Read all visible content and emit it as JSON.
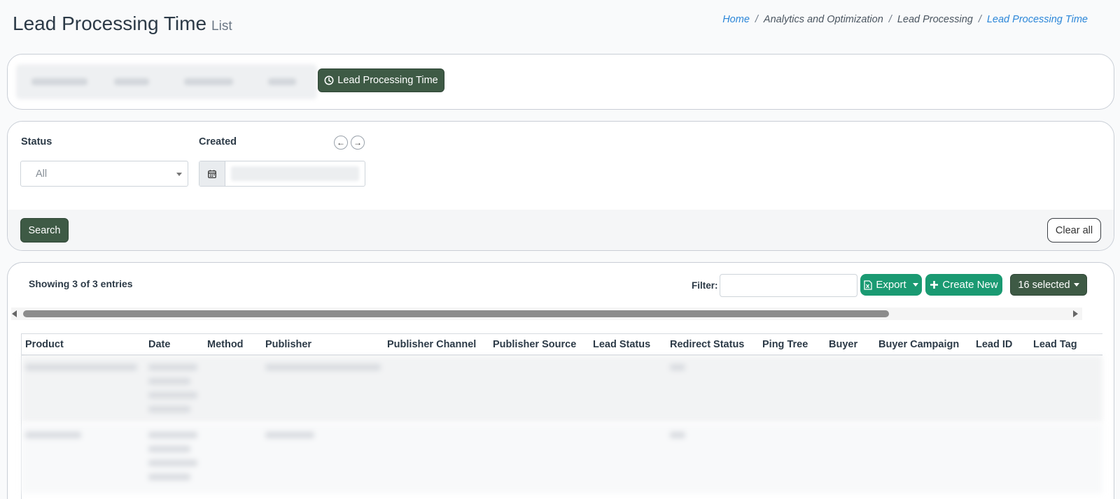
{
  "page": {
    "title": "Lead Processing Time",
    "subtitle": "List"
  },
  "breadcrumb": [
    "Home",
    "Analytics and Optimization",
    "Lead Processing",
    "Lead Processing Time"
  ],
  "tabs": {
    "active_label": "Lead Processing Time",
    "active_icon": "clock-icon"
  },
  "filters": {
    "status_label": "Status",
    "status_value": "All",
    "created_label": "Created",
    "search_label": "Search",
    "clear_label": "Clear all"
  },
  "table": {
    "showing": "Showing 3 of 3 entries",
    "filter_label": "Filter:",
    "filter_value": "",
    "export_label": "Export",
    "create_label": "Create New",
    "selected_label": "16 selected",
    "columns": [
      "Product",
      "Date",
      "Method",
      "Publisher",
      "Publisher Channel",
      "Publisher Source",
      "Lead Status",
      "Redirect Status",
      "Ping Tree",
      "Buyer",
      "Buyer Campaign",
      "Lead ID",
      "Lead Tag"
    ]
  },
  "colors": {
    "dark_green": "#3e5a45",
    "accent_green": "#1a9a72",
    "link_blue": "#2b86d8"
  }
}
